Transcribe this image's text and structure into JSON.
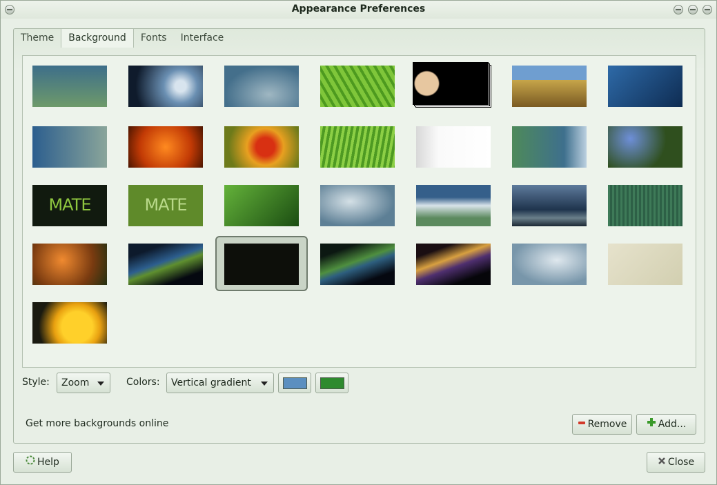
{
  "window": {
    "title": "Appearance Preferences"
  },
  "tabs": [
    "Theme",
    "Background",
    "Fonts",
    "Interface"
  ],
  "controls": {
    "style_label": "Style:",
    "style_value": "Zoom",
    "colors_label": "Colors:",
    "colors_value": "Vertical gradient",
    "primary_color": "#5b8fc0",
    "secondary_color": "#2e8a2e",
    "more_link": "Get more backgrounds online",
    "remove": "Remove",
    "add": "Add...",
    "help": "Help",
    "close": "Close"
  },
  "wallpapers": [
    {
      "name": "blue-green-gradient",
      "bg": "linear-gradient(#3d6e8a,#6e9a6a)"
    },
    {
      "name": "water-drop",
      "bg": "radial-gradient(circle at 70% 50%,#d8e4ee 0 10%,#6a8fb2 30%,#0f1b2c 80%)"
    },
    {
      "name": "blue-waves",
      "bg": "radial-gradient(ellipse at 60% 70%,#9fb7c2,#446f8b 70%)"
    },
    {
      "name": "green-leaf",
      "bg": "repeating-linear-gradient(60deg,#7fc63a 0 6px,#4d9a1f 6px 10px)"
    },
    {
      "name": "jupiter",
      "bg": "radial-gradient(circle at 18% 50%,#e7c7a0 0 18%,#000 20%)",
      "stack": true
    },
    {
      "name": "beach-grass",
      "bg": "linear-gradient(#6f9ed0 0 35%,#c6a54a 35%,#7a5a22)"
    },
    {
      "name": "blue-bubbles",
      "bg": "linear-gradient(135deg,#2e6aa8,#0e2c52)"
    },
    {
      "name": "blue-drops",
      "bg": "linear-gradient(90deg,#2c5e8e,#8aa59a)"
    },
    {
      "name": "orange-flower",
      "bg": "radial-gradient(circle at 50% 50%,#ff8a20,#c23a05 60%,#4c1500)"
    },
    {
      "name": "red-marigold",
      "bg": "radial-gradient(circle at 55% 50%,#d83012 0 20%,#e8a020 40%,#6d7a1a 80%)"
    },
    {
      "name": "green-grass",
      "bg": "repeating-linear-gradient(100deg,#8ccf45 0 4px,#4e9a22 4px 8px)"
    },
    {
      "name": "mate-light",
      "bg": "linear-gradient(90deg,#d8d8d8,#fafafa 30%,#fff)"
    },
    {
      "name": "green-blue-edge",
      "bg": "linear-gradient(90deg,#4e8a5a,#3e6f8d 70%,#bcd0e0)"
    },
    {
      "name": "blue-flowers",
      "bg": "radial-gradient(circle at 30% 30%,#6e8fd8,#2f4f1e 60%)"
    },
    {
      "name": "mate-dark",
      "bg": "#111a0f",
      "text": "MATE",
      "tc": "#8ec63f"
    },
    {
      "name": "mate-green",
      "bg": "#5f8a2a",
      "text": "MATE",
      "tc": "#b9d98a"
    },
    {
      "name": "leaf-drops",
      "bg": "linear-gradient(135deg,#64b23a,#1b4d12)"
    },
    {
      "name": "soft-waves-blue",
      "bg": "radial-gradient(ellipse at 40% 40%,#d4e0e6,#5d7f95 70%)"
    },
    {
      "name": "blue-white-wave",
      "bg": "linear-gradient(#355f8a 0 30%,#d9e4ea 50%,#5c8a5e 80%)"
    },
    {
      "name": "storm-sea",
      "bg": "linear-gradient(#5e7b9c,#1f344d 60%,#6a7f8a 80%,#1b2733)"
    },
    {
      "name": "green-stripes",
      "bg": "repeating-linear-gradient(90deg,#3e7a58 0 3px,#2d6046 3px 6px)"
    },
    {
      "name": "dandelion",
      "bg": "radial-gradient(circle at 40% 40%,#f08a30,#7a3b10 60%,#233011)"
    },
    {
      "name": "aurora-1",
      "bg": "linear-gradient(160deg,#0d1a2c 20%,#2d5f8f 45%,#5f8f2f 55%,#050810 80%)"
    },
    {
      "name": "dark-aurora",
      "bg": "#0d0f0a",
      "selected": true
    },
    {
      "name": "aurora-2",
      "bg": "linear-gradient(160deg,#0c1812 20%,#4f8f3f 45%,#2e5f7f 55%,#050810 80%)"
    },
    {
      "name": "aurora-3",
      "bg": "linear-gradient(160deg,#1a0e12 20%,#d8a040 40%,#4f2f6f 55%,#06060a 80%)"
    },
    {
      "name": "blue-curves",
      "bg": "radial-gradient(ellipse at 60% 40%,#dfe8ee,#7896aa 70%)"
    },
    {
      "name": "cream-fabric",
      "bg": "linear-gradient(135deg,#e6e2cc,#d2cfb0)"
    },
    {
      "name": "yellow-flower",
      "bg": "radial-gradient(circle at 60% 60%,#ffd02a 0 30%,#e8a010 45%,#1a1a10 75%)"
    }
  ]
}
